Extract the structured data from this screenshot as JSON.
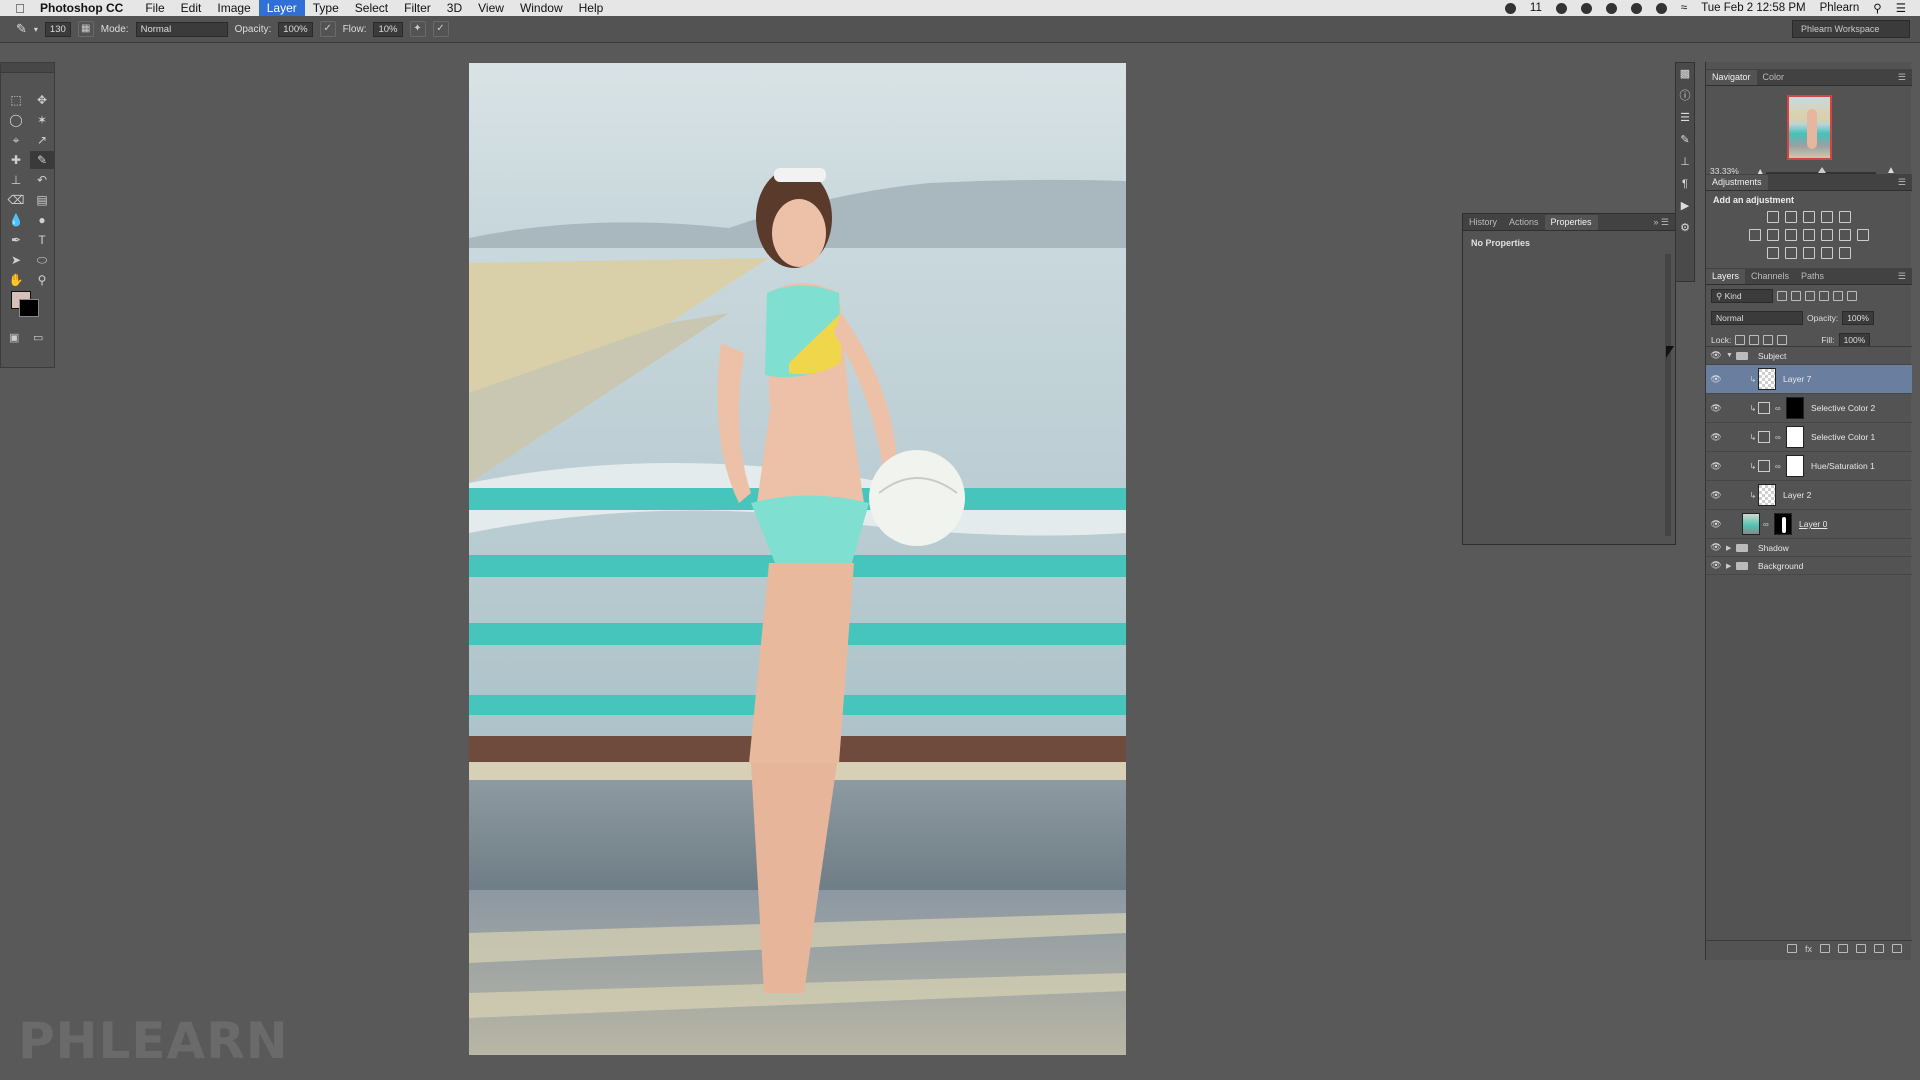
{
  "menubar": {
    "app_name": "Photoshop CC",
    "menus": [
      "File",
      "Edit",
      "Image",
      "Layer",
      "Type",
      "Select",
      "Filter",
      "3D",
      "View",
      "Window",
      "Help"
    ],
    "active_menu": "Layer",
    "status_num": "11",
    "datetime": "Tue Feb 2  12:58 PM",
    "user": "Phlearn"
  },
  "options": {
    "brush_size": "130",
    "mode_label": "Mode:",
    "mode_value": "Normal",
    "opacity_label": "Opacity:",
    "opacity_value": "100%",
    "flow_label": "Flow:",
    "flow_value": "10%",
    "workspace": "Phlearn Workspace"
  },
  "properties_panel": {
    "tabs": [
      "History",
      "Actions",
      "Properties"
    ],
    "active_tab": "Properties",
    "body": "No Properties"
  },
  "navigator_panel": {
    "tabs": [
      "Navigator",
      "Color"
    ],
    "zoom": "33.33%"
  },
  "adjustments_panel": {
    "title": "Adjustments",
    "subtitle": "Add an adjustment"
  },
  "layers_panel": {
    "tabs": [
      "Layers",
      "Channels",
      "Paths"
    ],
    "filter": "Kind",
    "blend_mode": "Normal",
    "opacity_label": "Opacity:",
    "opacity_value": "100%",
    "lock_label": "Lock:",
    "fill_label": "Fill:",
    "fill_value": "100%",
    "layers": [
      {
        "name": "Subject",
        "kind": "group-open"
      },
      {
        "name": "Layer 7",
        "kind": "pixel",
        "selected": true
      },
      {
        "name": "Selective Color 2",
        "kind": "adjustment",
        "mask": "black"
      },
      {
        "name": "Selective Color 1",
        "kind": "adjustment",
        "mask": "white"
      },
      {
        "name": "Hue/Saturation 1",
        "kind": "adjustment",
        "mask": "white"
      },
      {
        "name": "Layer 2",
        "kind": "pixel"
      },
      {
        "name": "Layer 0",
        "kind": "photo"
      },
      {
        "name": "Shadow",
        "kind": "group-closed"
      },
      {
        "name": "Background",
        "kind": "group-closed"
      }
    ]
  },
  "watermark": "PHLEARN",
  "colors": {
    "foreground": "#d8bfb8",
    "background": "#000000",
    "selection": "#6a7ea0",
    "menu_active": "#2f6fd6"
  }
}
